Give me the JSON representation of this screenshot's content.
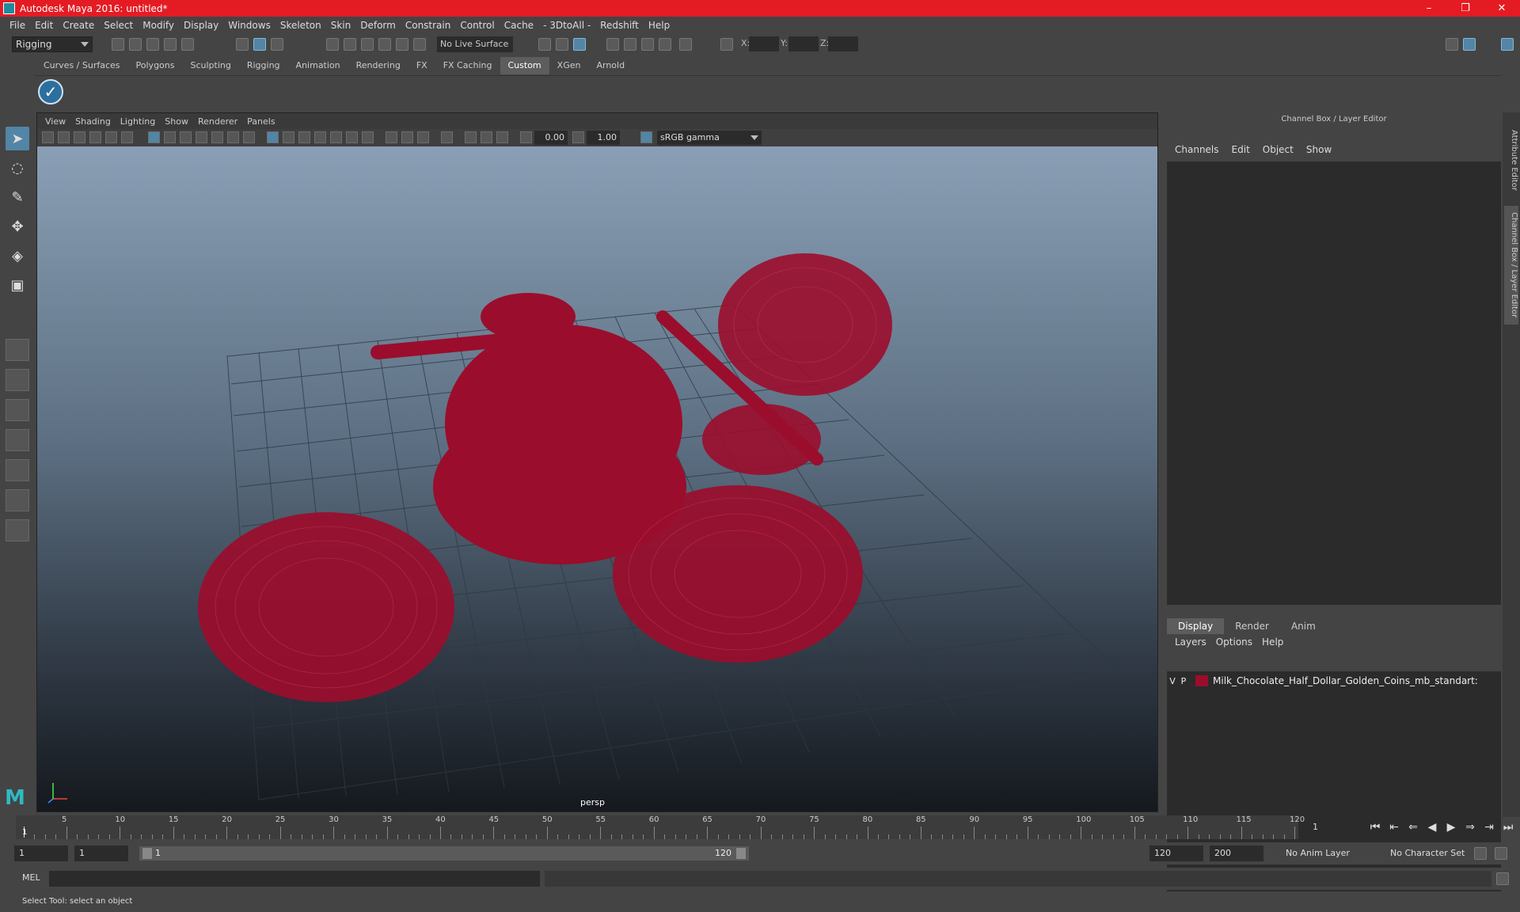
{
  "window": {
    "title": "Autodesk Maya 2016: untitled*",
    "controls": [
      "–",
      "❐",
      "✕"
    ]
  },
  "menubar": [
    "File",
    "Edit",
    "Create",
    "Select",
    "Modify",
    "Display",
    "Windows",
    "Skeleton",
    "Skin",
    "Deform",
    "Constrain",
    "Control",
    "Cache",
    "- 3DtoAll -",
    "Redshift",
    "Help"
  ],
  "statusline": {
    "mode": "Rigging",
    "live_surface": "No Live Surface",
    "x_label": "X:",
    "y_label": "Y:",
    "z_label": "Z:"
  },
  "shelf": {
    "tabs": [
      "Curves / Surfaces",
      "Polygons",
      "Sculpting",
      "Rigging",
      "Animation",
      "Rendering",
      "FX",
      "FX Caching",
      "Custom",
      "XGen",
      "Arnold"
    ],
    "active_tab": "Custom"
  },
  "viewport": {
    "menu": [
      "View",
      "Shading",
      "Lighting",
      "Show",
      "Renderer",
      "Panels"
    ],
    "exposure": "0.00",
    "gamma": "1.00",
    "color_space": "sRGB gamma",
    "camera_label": "persp",
    "wire_color": "#9b0d2c"
  },
  "channel_box": {
    "header": "Channel Box / Layer Editor",
    "menu": [
      "Channels",
      "Edit",
      "Object",
      "Show"
    ]
  },
  "layer_editor": {
    "tabs": [
      "Display",
      "Render",
      "Anim"
    ],
    "active_tab": "Display",
    "menu": [
      "Layers",
      "Options",
      "Help"
    ],
    "layers": [
      {
        "v": "V",
        "p": "P",
        "color": "#9b0d2c",
        "name": "Milk_Chocolate_Half_Dollar_Golden_Coins_mb_standart:"
      }
    ]
  },
  "side_tabs": [
    "Attribute Editor",
    "Channel Box / Layer Editor"
  ],
  "timeline": {
    "ticks": [
      "5",
      "10",
      "15",
      "20",
      "25",
      "30",
      "35",
      "40",
      "45",
      "50",
      "55",
      "60",
      "65",
      "70",
      "75",
      "80",
      "85",
      "90",
      "95",
      "100",
      "105",
      "110",
      "115",
      "120"
    ],
    "current_marker": "1",
    "current_frame": "1"
  },
  "range": {
    "start": "1",
    "playback_start": "1",
    "slider_lo": "1",
    "slider_hi": "120",
    "playback_end": "120",
    "end": "200",
    "anim_layer": "No Anim Layer",
    "character_set": "No Character Set"
  },
  "command_line": {
    "label": "MEL"
  },
  "help_line": "Select Tool: select an object"
}
